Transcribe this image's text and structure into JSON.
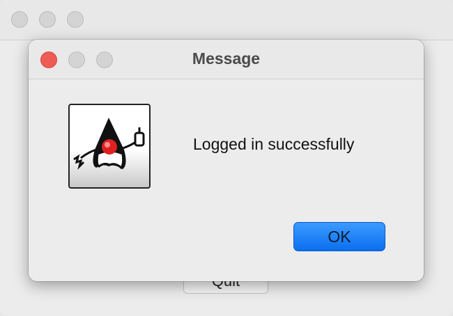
{
  "background_window": {
    "button_label": "Quit"
  },
  "dialog": {
    "title": "Message",
    "message": "Logged in successfully",
    "icon": "duke-java-mascot-icon",
    "ok_label": "OK"
  },
  "colors": {
    "close": "#ee5d55",
    "inactive_light": "#d4d4d4",
    "accent": "#0a6ff0"
  }
}
